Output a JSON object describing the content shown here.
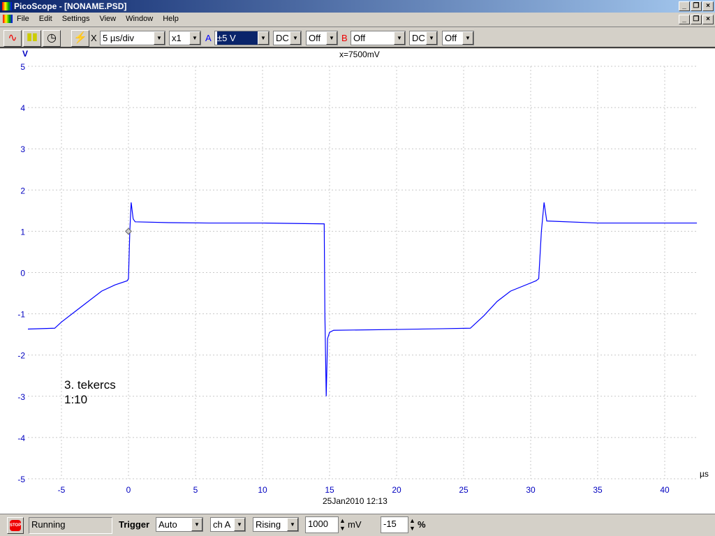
{
  "window": {
    "title": "PicoScope - [NONAME.PSD]"
  },
  "menu": [
    "File",
    "Edit",
    "Settings",
    "View",
    "Window",
    "Help"
  ],
  "toolbar": {
    "x_label": "X",
    "timebase": "5 µs/div",
    "multiplier": "x1",
    "a_label": "A",
    "a_range": "±5 V",
    "a_coupling": "DC",
    "a_extra": "Off",
    "b_label": "B",
    "b_range": "Off",
    "b_coupling": "DC",
    "b_extra": "Off"
  },
  "plot": {
    "y_unit": "V",
    "x_unit": "µs",
    "readout": "x=7500mV",
    "annotation": [
      "3. tekercs",
      "1:10"
    ],
    "timestamp": "25Jan2010  12:13",
    "trace_color": "#0000ff",
    "axis_color": "#0000c0"
  },
  "chart_data": {
    "type": "line",
    "xlim": [
      -7.5,
      42.5
    ],
    "ylim": [
      -5,
      5
    ],
    "xticks": [
      -5,
      0,
      5,
      10,
      15,
      20,
      25,
      30,
      35,
      40
    ],
    "yticks": [
      5,
      4,
      3,
      2,
      1,
      0,
      -1,
      -2,
      -3,
      -4,
      -5
    ],
    "series": [
      {
        "name": "ch A",
        "x": [
          -7.5,
          -5.5,
          -5,
          -4,
          -3,
          -2,
          -1,
          -0.1,
          0,
          0.1,
          0.2,
          0.35,
          0.5,
          3,
          6,
          10,
          14.6,
          14.65,
          14.75,
          14.85,
          15,
          15.3,
          20,
          25.5,
          26.5,
          27.5,
          28.5,
          30.4,
          30.6,
          30.8,
          31.0,
          31.2,
          35,
          40,
          42.4
        ],
        "y": [
          -1.37,
          -1.35,
          -1.2,
          -0.95,
          -0.7,
          -0.45,
          -0.3,
          -0.2,
          -0.15,
          1.0,
          1.7,
          1.3,
          1.23,
          1.21,
          1.2,
          1.2,
          1.18,
          -1.0,
          -3.0,
          -1.6,
          -1.45,
          -1.4,
          -1.38,
          -1.35,
          -1.05,
          -0.7,
          -0.45,
          -0.2,
          -0.15,
          1.0,
          1.7,
          1.25,
          1.2,
          1.2,
          1.2
        ]
      }
    ],
    "trigger_marker": {
      "x": 0,
      "y": 1.0
    }
  },
  "status": {
    "state": "Running",
    "trigger_label": "Trigger",
    "trigger_mode": "Auto",
    "trigger_channel": "ch A",
    "trigger_edge": "Rising",
    "threshold": "1000",
    "threshold_unit": "mV",
    "delay": "-15",
    "delay_unit": "%"
  }
}
